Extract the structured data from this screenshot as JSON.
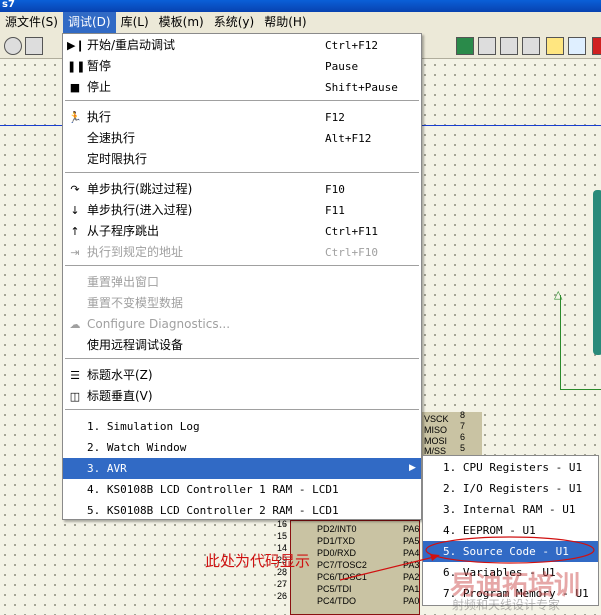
{
  "title": "s7",
  "menubar": [
    "源文件(S)",
    "调试(D)",
    "库(L)",
    "模板(m)",
    "系统(y)",
    "帮助(H)"
  ],
  "debug_menu": [
    {
      "icon": "play-pause-icon",
      "label": "开始/重启动调试",
      "shortcut": "Ctrl+F12"
    },
    {
      "icon": "pause-icon",
      "label": "暂停",
      "shortcut": "Pause"
    },
    {
      "icon": "stop-icon",
      "label": "停止",
      "shortcut": "Shift+Pause"
    },
    {
      "icon": "run-icon",
      "label": "执行",
      "shortcut": "F12"
    },
    {
      "icon": "",
      "label": "全速执行",
      "shortcut": "Alt+F12"
    },
    {
      "icon": "",
      "label": "定时限执行",
      "shortcut": ""
    },
    {
      "icon": "step-over-icon",
      "label": "单步执行(跳过过程)",
      "shortcut": "F10"
    },
    {
      "icon": "step-into-icon",
      "label": "单步执行(进入过程)",
      "shortcut": "F11"
    },
    {
      "icon": "step-out-icon",
      "label": "从子程序跳出",
      "shortcut": "Ctrl+F11"
    },
    {
      "icon": "run-to-icon",
      "label": "执行到规定的地址",
      "shortcut": "Ctrl+F10",
      "disabled": true
    },
    {
      "icon": "",
      "label": "重置弹出窗口",
      "shortcut": "",
      "disabled": true
    },
    {
      "icon": "",
      "label": "重置不变模型数据",
      "shortcut": "",
      "disabled": true
    },
    {
      "icon": "cloud-icon",
      "label": "Configure Diagnostics...",
      "shortcut": "",
      "disabled": true
    },
    {
      "icon": "",
      "label": "使用远程调试设备",
      "shortcut": ""
    },
    {
      "icon": "tile-horizontal-icon",
      "label": "标题水平(Z)",
      "shortcut": ""
    },
    {
      "icon": "tile-vertical-icon",
      "label": "标题垂直(V)",
      "shortcut": ""
    },
    {
      "icon": "",
      "label": "1. Simulation Log",
      "shortcut": ""
    },
    {
      "icon": "",
      "label": "2. Watch Window",
      "shortcut": ""
    },
    {
      "icon": "",
      "label": "3. AVR",
      "shortcut": "",
      "submenu": true
    },
    {
      "icon": "",
      "label": "4. KS0108B LCD Controller 1 RAM - LCD1",
      "shortcut": ""
    },
    {
      "icon": "",
      "label": "5. KS0108B LCD Controller 2 RAM - LCD1",
      "shortcut": ""
    }
  ],
  "avr_submenu": [
    "1. CPU Registers - U1",
    "2. I/O Registers - U1",
    "3. Internal RAM - U1",
    "4. EEPROM - U1",
    "5. Source Code - U1",
    "6. Variables - U1",
    "7. Program Memory - U1"
  ],
  "chip_pins_left": [
    [
      "16",
      "PD2/INT0"
    ],
    [
      "15",
      "PD1/TXD"
    ],
    [
      "14",
      "PD0/RXD"
    ],
    [
      "29",
      "PC7/TOSC2"
    ],
    [
      "28",
      "PC6/TOSC1"
    ],
    [
      "27",
      "PC5/TDI"
    ],
    [
      "26",
      "PC4/TDO"
    ]
  ],
  "chip_pins_right": [
    "PA6",
    "PA5",
    "PA4",
    "PA3",
    "PA2",
    "PA1",
    "PA0"
  ],
  "spi_pins": [
    [
      "VSCK",
      "8"
    ],
    [
      "MISO",
      "7"
    ],
    [
      "MOSI",
      "6"
    ],
    [
      "M/SS",
      "5"
    ]
  ],
  "annotation": "此处为代码显示",
  "watermark": {
    "main": "易迪拓培训",
    "sub": "射频和天线设计专家"
  },
  "colors": {
    "highlight": "#316ac5",
    "annotation": "#d01010"
  }
}
